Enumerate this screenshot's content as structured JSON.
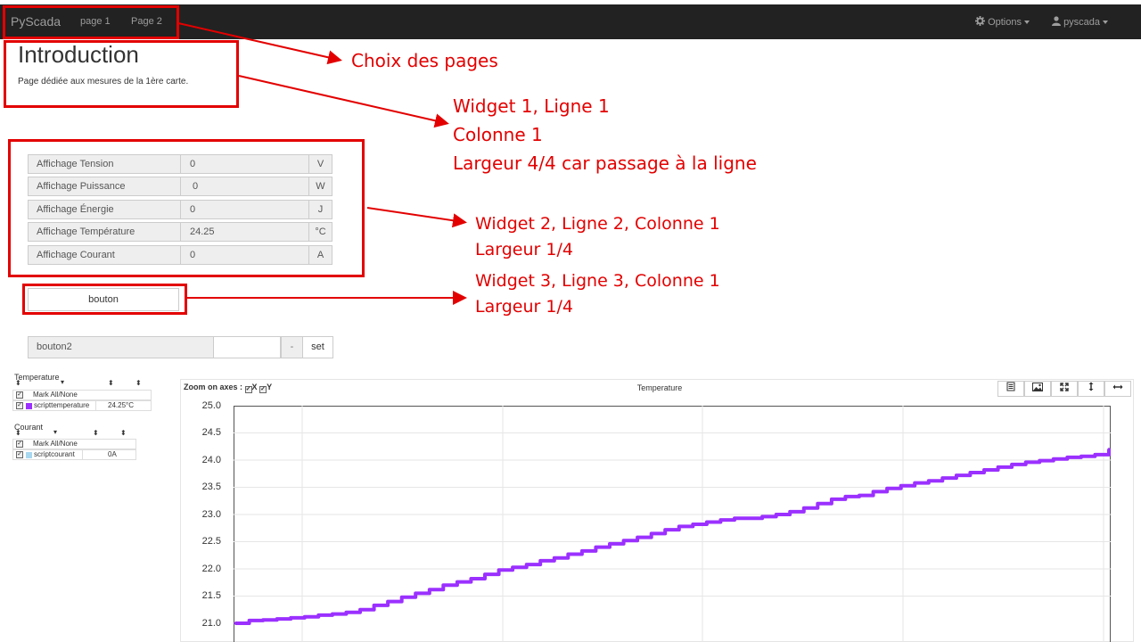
{
  "navbar": {
    "brand": "PyScada",
    "links": [
      "page 1",
      "Page 2"
    ],
    "options_label": "Options",
    "user_label": "pyscada",
    "icons": {
      "options": "gear-icon",
      "user": "user-icon"
    }
  },
  "intro": {
    "title": "Introduction",
    "subtitle": "Page dédiée aux mesures de la 1ère carte."
  },
  "displays": [
    {
      "label": "Affichage Tension",
      "value": "0",
      "unit": "V"
    },
    {
      "label": "Affichage Puissance",
      "value": "0",
      "unit": "W"
    },
    {
      "label": "Affichage Énergie",
      "value": "0",
      "unit": "J"
    },
    {
      "label": "Affichage Température",
      "value": "24.25",
      "unit": "°C"
    },
    {
      "label": "Affichage Courant",
      "value": "0",
      "unit": "A"
    }
  ],
  "button1": {
    "label": "bouton"
  },
  "button2": {
    "label": "bouton2",
    "input_value": "",
    "minus_label": "-",
    "set_label": "set"
  },
  "legends": [
    {
      "title": "Temperature",
      "mark_all": "Mark All/None",
      "variable": "scripttemperature",
      "value": "24.25°C",
      "color": "#9b30ff"
    },
    {
      "title": "Courant",
      "mark_all": "Mark All/None",
      "variable": "scriptcourant",
      "value": "0A",
      "color": "#a8d8f0"
    }
  ],
  "chart": {
    "zoom_label": "Zoom on axes :",
    "zoom_x": "X",
    "zoom_y": "Y",
    "toolbar_icons": [
      "data-table-icon",
      "image-icon",
      "fullscreen-icon",
      "vertical-resize-icon",
      "horizontal-resize-icon"
    ]
  },
  "annotations": {
    "pages": "Choix des pages",
    "widget1": [
      "Widget 1, Ligne 1",
      "Colonne 1",
      "Largeur 4/4 car passage à la ligne"
    ],
    "widget2": [
      "Widget 2, Ligne 2, Colonne 1",
      "Largeur 1/4"
    ],
    "widget3": [
      "Widget 3, Ligne 3, Colonne 1",
      "Largeur 1/4"
    ],
    "color": "#e30000"
  },
  "chart_data": {
    "type": "line",
    "title": "Temperature",
    "xlabel": "",
    "ylabel": "",
    "ylim": [
      21.0,
      25.0
    ],
    "yticks": [
      "25.0",
      "24.5",
      "24.0",
      "23.5",
      "23.0",
      "22.5",
      "22.0",
      "21.5",
      "21.0"
    ],
    "grid": true,
    "series": [
      {
        "name": "scripttemperature",
        "color": "#9b30ff",
        "values": [
          21.0,
          21.05,
          21.06,
          21.08,
          21.1,
          21.12,
          21.15,
          21.17,
          21.2,
          21.25,
          21.33,
          21.4,
          21.48,
          21.55,
          21.62,
          21.7,
          21.76,
          21.82,
          21.9,
          21.98,
          22.03,
          22.08,
          22.15,
          22.2,
          22.27,
          22.33,
          22.4,
          22.46,
          22.52,
          22.58,
          22.65,
          22.72,
          22.78,
          22.82,
          22.86,
          22.9,
          22.93,
          22.93,
          22.96,
          23.0,
          23.05,
          23.12,
          23.2,
          23.28,
          23.33,
          23.35,
          23.42,
          23.48,
          23.53,
          23.58,
          23.62,
          23.67,
          23.72,
          23.77,
          23.82,
          23.87,
          23.92,
          23.96,
          23.99,
          24.02,
          24.05,
          24.07,
          24.1,
          24.2
        ]
      }
    ]
  }
}
